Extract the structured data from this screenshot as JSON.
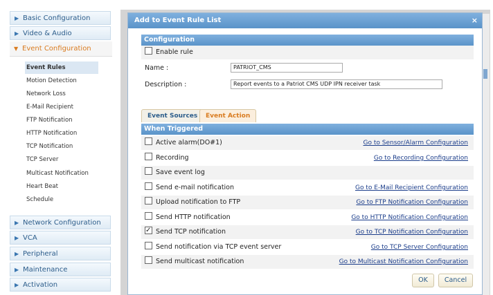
{
  "sidebar": {
    "top_items": [
      "Basic Configuration",
      "Video & Audio"
    ],
    "open_item": "Event Configuration",
    "sub_items": [
      "Event Rules",
      "Motion Detection",
      "Network Loss",
      "E-Mail Recipient",
      "FTP Notification",
      "HTTP Notification",
      "TCP Notification",
      "TCP Server",
      "Multicast Notification",
      "Heart Beat",
      "Schedule"
    ],
    "active_sub": "Event Rules",
    "bottom_items": [
      "Network Configuration",
      "VCA",
      "Peripheral",
      "Maintenance",
      "Activation"
    ]
  },
  "dialog": {
    "title": "Add to Event Rule List",
    "close_glyph": "×",
    "configuration": {
      "header": "Configuration",
      "enable_label": "Enable rule",
      "enable_checked": false,
      "name_label": "Name :",
      "name_value": "PATRIOT_CMS",
      "description_label": "Description :",
      "description_value": "Report events to a Patriot CMS UDP IPN receiver task"
    },
    "tabs": [
      "Event Sources",
      "Event Action"
    ],
    "active_tab": "Event Action",
    "triggered": {
      "header": "When Triggered",
      "rows": [
        {
          "label": "Active alarm(DO#1)",
          "checked": false,
          "link": "Go to Sensor/Alarm Configuration"
        },
        {
          "label": "Recording",
          "checked": false,
          "link": "Go to Recording Configuration"
        },
        {
          "label": "Save event log",
          "checked": false,
          "link": ""
        },
        {
          "label": "Send e-mail notification",
          "checked": false,
          "link": "Go to E-Mail Recipient Configuration"
        },
        {
          "label": "Upload notification to FTP",
          "checked": false,
          "link": "Go to FTP Notification Configuration"
        },
        {
          "label": "Send HTTP notification",
          "checked": false,
          "link": "Go to HTTP Notification Configuration"
        },
        {
          "label": "Send TCP notification",
          "checked": true,
          "link": "Go to TCP Notification Configuration"
        },
        {
          "label": "Send notification via TCP event server",
          "checked": false,
          "link": "Go to TCP Server Configuration"
        },
        {
          "label": "Send multicast notification",
          "checked": false,
          "link": "Go to Multicast Notification Configuration"
        }
      ]
    },
    "buttons": {
      "ok": "OK",
      "cancel": "Cancel"
    }
  }
}
